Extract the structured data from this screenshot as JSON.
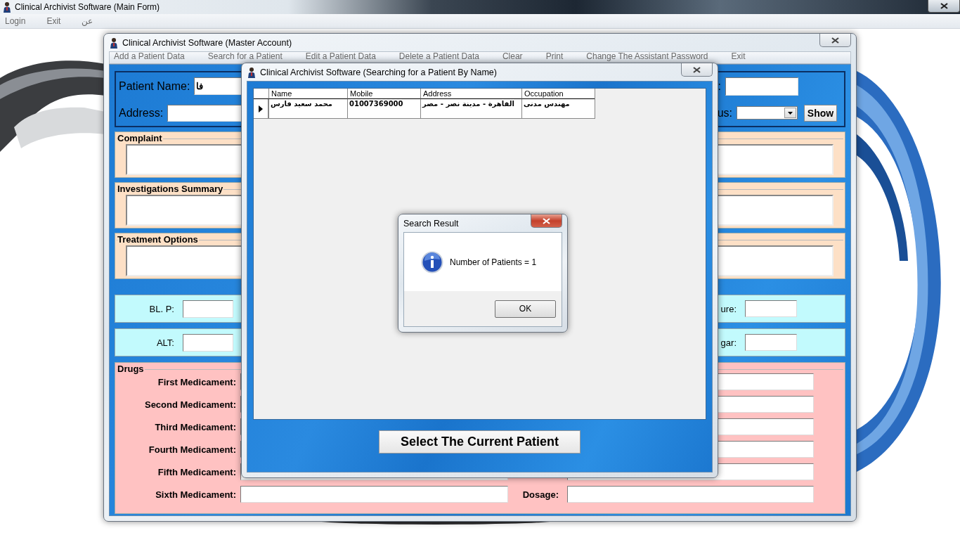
{
  "main_window": {
    "title": "Clinical Archivist Software (Main Form)",
    "menu": [
      "Login",
      "Exit",
      "عن"
    ]
  },
  "master_window": {
    "title": "Clinical Archivist Software (Master Account)",
    "menu": [
      "Add a Patient Data",
      "Search for a Patient",
      "Edit a Patient Data",
      "Delete a Patient Data",
      "Clear",
      "Print",
      "Change The Assistant Password",
      "Exit"
    ],
    "patient_panel": {
      "name_label": "Patient Name:",
      "name_value": "فا",
      "address_label": "Address:",
      "field_3_label": ":",
      "field_4_label": "us:",
      "show_button": "Show"
    },
    "text_sections": [
      "Complaint",
      "Investigations Summary",
      "Treatment Options"
    ],
    "vitals_rows": [
      {
        "left_label": "BL. P:",
        "right_label": "ure:"
      },
      {
        "left_label": "ALT:",
        "right_label": "gar:"
      }
    ],
    "drugs": {
      "title": "Drugs",
      "rows": [
        {
          "label": "First Medicament:"
        },
        {
          "label": "Second Medicament:"
        },
        {
          "label": "Third Medicament:"
        },
        {
          "label": "Fourth Medicament:"
        },
        {
          "label": "Fifth Medicament:"
        },
        {
          "label": "Sixth Medicament:",
          "dosage_label": "Dosage:"
        }
      ]
    }
  },
  "search_dialog": {
    "title": "Clinical Archivist Software (Searching for a Patient By Name)",
    "table": {
      "columns": [
        "Name",
        "Mobile",
        "Address",
        "Occupation"
      ],
      "rows": [
        {
          "selected": true,
          "cells": [
            "محمد سعيد فارس",
            "01007369000",
            "القاهرة - مدينة نصر - مصر",
            "مهندس مدنى"
          ]
        }
      ]
    },
    "select_button": "Select The Current Patient"
  },
  "message_box": {
    "title": "Search Result",
    "message": "Number of Patients = 1",
    "ok_button": "OK"
  }
}
